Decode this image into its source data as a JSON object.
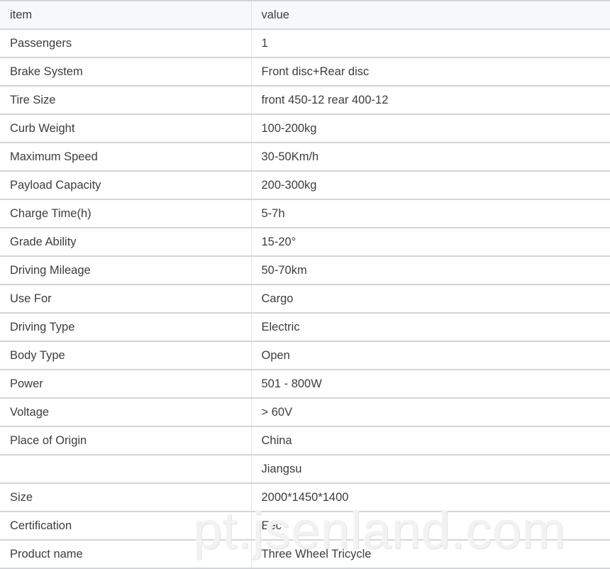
{
  "table": {
    "columns": [
      {
        "key": "item",
        "label": "item"
      },
      {
        "key": "value",
        "label": "value"
      }
    ],
    "rows": [
      {
        "item": "Passengers",
        "value": "1"
      },
      {
        "item": "Brake System",
        "value": "Front disc+Rear disc"
      },
      {
        "item": "Tire Size",
        "value": "front 450-12 rear 400-12"
      },
      {
        "item": "Curb Weight",
        "value": "100-200kg"
      },
      {
        "item": "Maximum Speed",
        "value": "30-50Km/h"
      },
      {
        "item": "Payload Capacity",
        "value": "200-300kg"
      },
      {
        "item": "Charge Time(h)",
        "value": "5-7h"
      },
      {
        "item": "Grade Ability",
        "value": "15-20°"
      },
      {
        "item": "Driving Mileage",
        "value": "50-70km"
      },
      {
        "item": "Use For",
        "value": "Cargo"
      },
      {
        "item": "Driving Type",
        "value": "Electric"
      },
      {
        "item": "Body Type",
        "value": "Open"
      },
      {
        "item": "Power",
        "value": "501 - 800W"
      },
      {
        "item": "Voltage",
        "value": "> 60V"
      },
      {
        "item": "Place of Origin",
        "value": "China"
      },
      {
        "item": "",
        "value": "Jiangsu"
      },
      {
        "item": "Size",
        "value": "2000*1450*1400"
      },
      {
        "item": "Certification",
        "value": "Eec"
      },
      {
        "item": "Product name",
        "value": "Three Wheel Tricycle"
      }
    ]
  },
  "watermark": {
    "text": "pt.jsenland.com"
  },
  "colors": {
    "header_background": "#f7f8f9",
    "row_border": "#d3d5d7",
    "column_divider": "#e2e3e5",
    "text": "#3d3d3f",
    "watermark": "#f2f2f2",
    "page_background": "#ffffff"
  }
}
